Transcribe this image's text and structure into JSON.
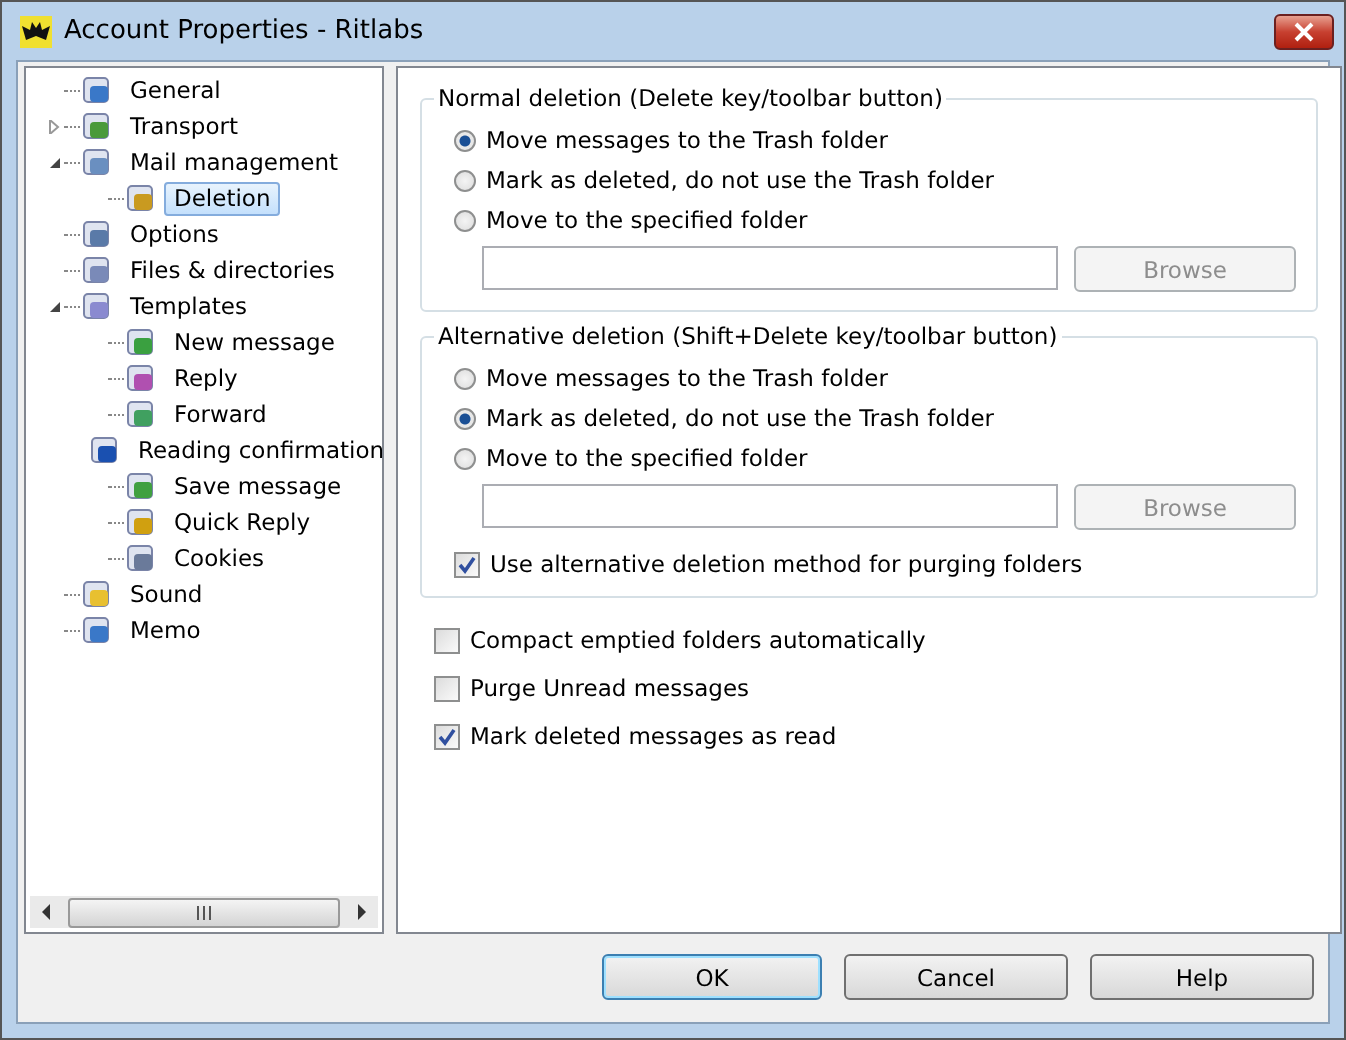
{
  "window": {
    "title": "Account Properties - Ritlabs"
  },
  "tree": [
    {
      "label": "General",
      "selected": false
    },
    {
      "label": "Transport",
      "selected": false,
      "expanded": false
    },
    {
      "label": "Mail management",
      "selected": false,
      "expanded": true,
      "children": [
        {
          "label": "Deletion",
          "selected": true
        }
      ]
    },
    {
      "label": "Options",
      "selected": false
    },
    {
      "label": "Files & directories",
      "selected": false
    },
    {
      "label": "Templates",
      "selected": false,
      "expanded": true,
      "children": [
        {
          "label": "New message",
          "selected": false
        },
        {
          "label": "Reply",
          "selected": false
        },
        {
          "label": "Forward",
          "selected": false
        },
        {
          "label": "Reading confirmation",
          "selected": false
        },
        {
          "label": "Save message",
          "selected": false
        },
        {
          "label": "Quick Reply",
          "selected": false
        },
        {
          "label": "Cookies",
          "selected": false
        }
      ]
    },
    {
      "label": "Sound",
      "selected": false
    },
    {
      "label": "Memo",
      "selected": false
    }
  ],
  "groups": [
    {
      "title": "Normal deletion (Delete key/toolbar button)",
      "options": [
        {
          "label": "Move messages to the Trash folder",
          "selected": true
        },
        {
          "label": "Mark as deleted, do not use the Trash folder",
          "selected": false
        },
        {
          "label": "Move to the specified folder",
          "selected": false
        }
      ],
      "browse": {
        "label": "Browse",
        "disabled": true
      }
    },
    {
      "title": "Alternative deletion (Shift+Delete key/toolbar button)",
      "options": [
        {
          "label": "Move messages to the Trash folder",
          "selected": false
        },
        {
          "label": "Mark as deleted, do not use the Trash folder",
          "selected": true
        },
        {
          "label": "Move to the specified folder",
          "selected": false
        }
      ],
      "browse": {
        "label": "Browse",
        "disabled": true
      },
      "checkbox": {
        "label": "Use alternative deletion method for purging folders",
        "checked": true
      }
    }
  ],
  "checkboxes": [
    {
      "label": "Compact emptied folders automatically",
      "checked": false
    },
    {
      "label": "Purge Unread messages",
      "checked": false
    },
    {
      "label": "Mark deleted messages as read",
      "checked": true
    }
  ],
  "buttons": [
    {
      "label": "OK",
      "default": true
    },
    {
      "label": "Cancel",
      "default": false
    },
    {
      "label": "Help",
      "default": false
    }
  ]
}
